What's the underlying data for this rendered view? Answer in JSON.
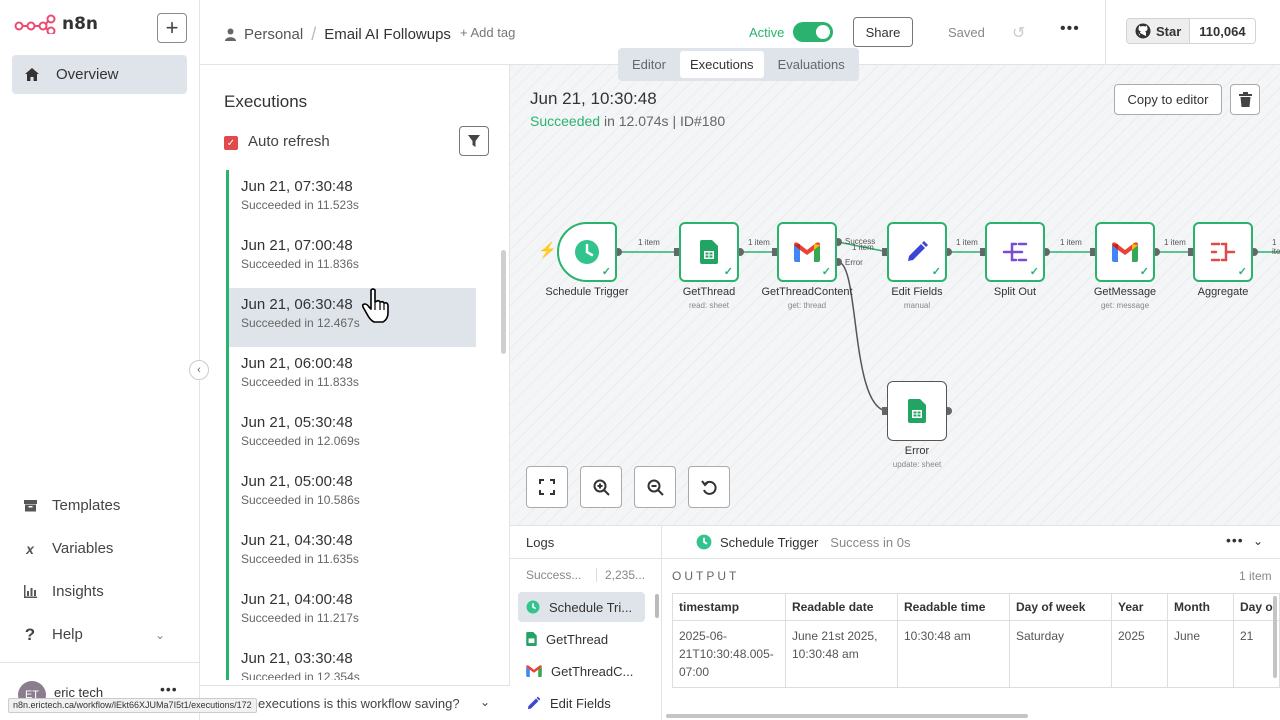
{
  "app": {
    "name": "n8n"
  },
  "sidebar": {
    "overview": "Overview",
    "items": [
      {
        "label": "Templates",
        "icon": "box-icon"
      },
      {
        "label": "Variables",
        "icon": "variable-icon"
      },
      {
        "label": "Insights",
        "icon": "chart-icon"
      },
      {
        "label": "Help",
        "icon": "question-icon"
      }
    ],
    "user": {
      "initials": "ET",
      "name": "eric tech"
    },
    "status_url": "n8n.erictech.ca/workflow/lEkt66XJUMa7I5t1/executions/172"
  },
  "header": {
    "project": "Personal",
    "workflow_name": "Email AI Followups",
    "add_tag": "+ Add tag",
    "active_label": "Active",
    "share": "Share",
    "saved": "Saved",
    "github_star": "Star",
    "github_count": "110,064"
  },
  "view_tabs": [
    "Editor",
    "Executions",
    "Evaluations"
  ],
  "executions": {
    "title": "Executions",
    "auto_refresh": "Auto refresh",
    "items": [
      {
        "date": "Jun 21, 07:30:48",
        "status": "Succeeded in 11.523s"
      },
      {
        "date": "Jun 21, 07:00:48",
        "status": "Succeeded in 11.836s"
      },
      {
        "date": "Jun 21, 06:30:48",
        "status": "Succeeded in 12.467s"
      },
      {
        "date": "Jun 21, 06:00:48",
        "status": "Succeeded in 11.833s"
      },
      {
        "date": "Jun 21, 05:30:48",
        "status": "Succeeded in 12.069s"
      },
      {
        "date": "Jun 21, 05:00:48",
        "status": "Succeeded in 10.586s"
      },
      {
        "date": "Jun 21, 04:30:48",
        "status": "Succeeded in 11.635s"
      },
      {
        "date": "Jun 21, 04:00:48",
        "status": "Succeeded in 11.217s"
      },
      {
        "date": "Jun 21, 03:30:48",
        "status": "Succeeded in 12.354s"
      }
    ],
    "bottom_question": "executions is this workflow saving?"
  },
  "run": {
    "date": "Jun 21, 10:30:48",
    "status_word": "Succeeded",
    "status_rest": " in 12.074s | ID#180",
    "copy_to_editor": "Copy to editor"
  },
  "workflow": {
    "nodes": [
      {
        "name": "Schedule Trigger",
        "sub": "",
        "icon": "clock-icon"
      },
      {
        "name": "GetThread",
        "sub": "read: sheet",
        "icon": "sheets-icon"
      },
      {
        "name": "GetThreadContent",
        "sub": "get: thread",
        "icon": "gmail-icon"
      },
      {
        "name": "Edit Fields",
        "sub": "manual",
        "icon": "pencil-icon"
      },
      {
        "name": "Split Out",
        "sub": "",
        "icon": "split-icon"
      },
      {
        "name": "GetMessage",
        "sub": "get: message",
        "icon": "gmail-icon"
      },
      {
        "name": "Aggregate",
        "sub": "",
        "icon": "aggregate-icon"
      },
      {
        "name": "Error",
        "sub": "update: sheet",
        "icon": "sheets-icon"
      }
    ],
    "connection_label": "1 item",
    "success_label": "Success",
    "error_label": "Error"
  },
  "logs": {
    "title": "Logs",
    "filter": "Success...",
    "count": "2,235...",
    "items": [
      {
        "label": "Schedule Tri...",
        "icon": "clock-icon"
      },
      {
        "label": "GetThread",
        "icon": "sheets-icon"
      },
      {
        "label": "GetThreadC...",
        "icon": "gmail-icon"
      },
      {
        "label": "Edit Fields",
        "icon": "pencil-icon"
      }
    ],
    "selected_node": "Schedule Trigger",
    "selected_status": "Success in 0s",
    "output_label": "OUTPUT",
    "items_count": "1 item",
    "columns": [
      "timestamp",
      "Readable date",
      "Readable time",
      "Day of week",
      "Year",
      "Month",
      "Day o"
    ],
    "row": [
      "2025-06-21T10:30:48.005-07:00",
      "June 21st 2025, 10:30:48 am",
      "10:30:48 am",
      "Saturday",
      "2025",
      "June",
      "21"
    ]
  },
  "colors": {
    "success": "#29b36d",
    "danger": "#e04a4a",
    "selected_bg": "#dfe3ea"
  }
}
